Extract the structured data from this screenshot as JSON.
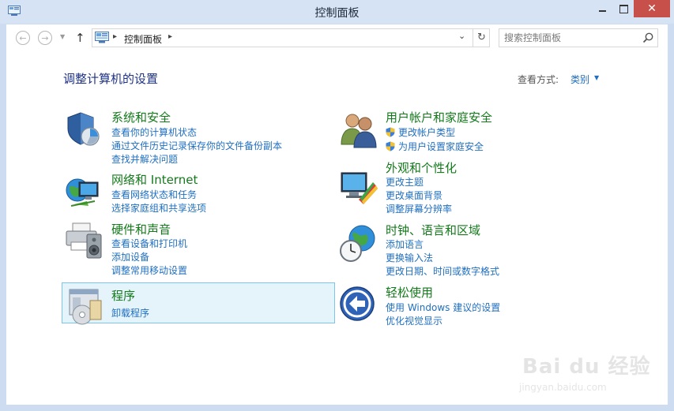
{
  "window": {
    "title": "控制面板",
    "close_glyph": "✕"
  },
  "nav": {
    "back_glyph": "←",
    "forward_glyph": "→",
    "recent_glyph": "▼",
    "up_glyph": "↑"
  },
  "address": {
    "crumb": "控制面板",
    "separator": "▸",
    "dropdown_glyph": "⌄",
    "refresh_glyph": "↻"
  },
  "search": {
    "placeholder": "搜索控制面板"
  },
  "page": {
    "title": "调整计算机的设置",
    "view_by_label": "查看方式:",
    "view_by_value": "类别",
    "view_by_arrow": "▼"
  },
  "categories": [
    {
      "title": "系统和安全",
      "icon": "shield-icon",
      "links": [
        "查看你的计算机状态",
        "通过文件历史记录保存你的文件备份副本",
        "查找并解决问题"
      ]
    },
    {
      "title": "网络和 Internet",
      "icon": "network-globe-icon",
      "links": [
        "查看网络状态和任务",
        "选择家庭组和共享选项"
      ]
    },
    {
      "title": "硬件和声音",
      "icon": "printer-speaker-icon",
      "links": [
        "查看设备和打印机",
        "添加设备",
        "调整常用移动设置"
      ]
    },
    {
      "title": "程序",
      "icon": "programs-icon",
      "links": [
        "卸载程序"
      ]
    },
    {
      "title": "用户帐户和家庭安全",
      "icon": "users-icon",
      "links": [
        "更改帐户类型",
        "为用户设置家庭安全"
      ]
    },
    {
      "title": "外观和个性化",
      "icon": "monitor-palette-icon",
      "links": [
        "更改主题",
        "更改桌面背景",
        "调整屏幕分辨率"
      ]
    },
    {
      "title": "时钟、语言和区域",
      "icon": "clock-globe-icon",
      "links": [
        "添加语言",
        "更换输入法",
        "更改日期、时间或数字格式"
      ]
    },
    {
      "title": "轻松使用",
      "icon": "ease-of-access-icon",
      "links": [
        "使用 Windows 建议的设置",
        "优化视觉显示"
      ]
    }
  ],
  "watermark": {
    "text": "Bai du 经验",
    "url": "jingyan.baidu.com"
  },
  "colors": {
    "link": "#1f6fc0",
    "category_title": "#137a1a",
    "page_title": "#1e3287",
    "close_button": "#c7504a",
    "selected_bg": "#e5f3fb"
  }
}
